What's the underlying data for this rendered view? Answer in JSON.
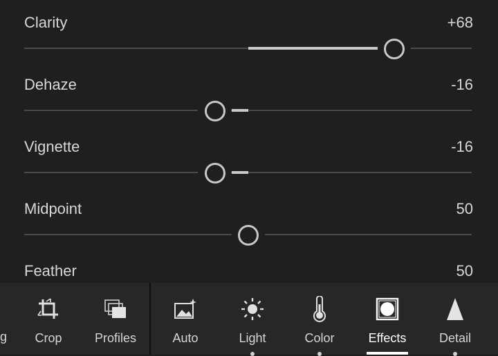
{
  "sliders": [
    {
      "label": "Clarity",
      "value": "+68",
      "level": 68
    },
    {
      "label": "Dehaze",
      "value": "-16",
      "level": -16
    },
    {
      "label": "Vignette",
      "value": "-16",
      "level": -16
    },
    {
      "label": "Midpoint",
      "value": "50",
      "level": 50
    },
    {
      "label": "Feather",
      "value": "50",
      "level": 50
    }
  ],
  "toolbar": {
    "edge_fragment": "g",
    "items": [
      {
        "label": "Crop",
        "icon": "crop-icon"
      },
      {
        "label": "Profiles",
        "icon": "profiles-icon"
      },
      {
        "label": "Auto",
        "icon": "auto-icon"
      },
      {
        "label": "Light",
        "icon": "light-icon"
      },
      {
        "label": "Color",
        "icon": "thermometer-icon"
      },
      {
        "label": "Effects",
        "icon": "effects-icon",
        "active": true
      },
      {
        "label": "Detail",
        "icon": "detail-icon"
      }
    ]
  },
  "colors": {
    "background": "#1f1f1f",
    "toolbar": "#272727",
    "track": "#4a4a4a",
    "fill": "#c9c9c9",
    "active": "#ffffff"
  }
}
